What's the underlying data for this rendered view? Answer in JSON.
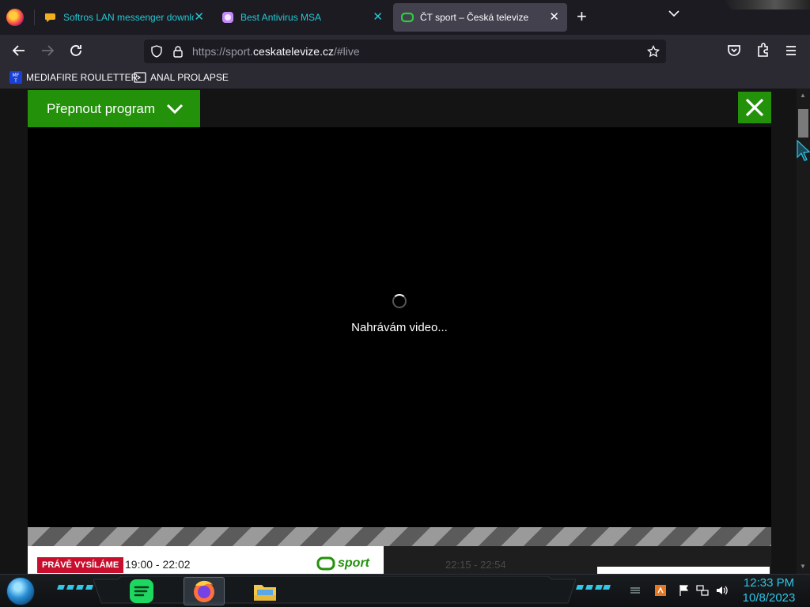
{
  "browser": {
    "tabs": [
      {
        "title": "Softros LAN messenger downlo",
        "icon": "softros-icon",
        "active": false
      },
      {
        "title": "Best Antivirus MSA",
        "icon": "antivirus-icon",
        "active": false
      },
      {
        "title": "ČT sport – Česká televize",
        "icon": "ct-sport-icon",
        "active": true
      }
    ],
    "new_tab_label": "+",
    "url": {
      "scheme": "https://sport.",
      "domain": "ceskatelevize.cz",
      "path": "/#live"
    },
    "bookmarks": [
      {
        "label": "MEDIAFIRE ROULETTER",
        "icon": "mediafire-icon"
      },
      {
        "label": "ANAL PROLAPSE",
        "icon": "bookmark-page-icon"
      }
    ]
  },
  "page": {
    "switch_program_label": "Přepnout program",
    "loading_text": "Nahrávám video...",
    "now_playing": {
      "badge": "PRÁVĚ VYSÍLÁME",
      "time": "19:00 - 22:02",
      "channel": "sport"
    },
    "next": {
      "time": "22:15 - 22:54"
    },
    "colors": {
      "brand_green": "#23920a",
      "badge_red": "#c8102e"
    }
  },
  "taskbar": {
    "clock_time": "12:33 PM",
    "clock_date": "10/8/2023",
    "pinned": [
      "spotify-icon",
      "firefox-icon",
      "file-explorer-icon"
    ]
  }
}
